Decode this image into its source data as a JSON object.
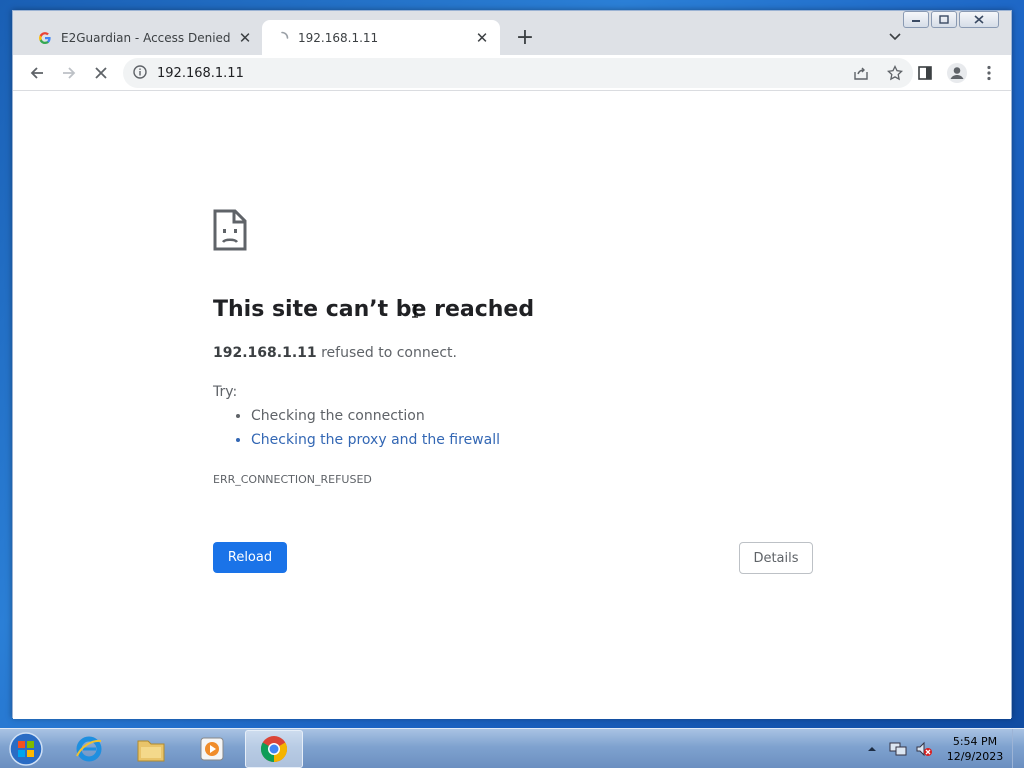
{
  "browser": {
    "tabs": [
      {
        "title": "E2Guardian - Access Denied",
        "favicon": "google-g-icon"
      },
      {
        "title": "192.168.1.11",
        "favicon": "loading-spinner-icon"
      }
    ],
    "url": "192.168.1.11"
  },
  "error_page": {
    "title": "This site can’t be reached",
    "host": "192.168.1.11",
    "message_suffix": " refused to connect.",
    "try_label": "Try:",
    "suggestions": [
      "Checking the connection",
      "Checking the proxy and the firewall"
    ],
    "error_code": "ERR_CONNECTION_REFUSED",
    "reload_label": "Reload",
    "details_label": "Details"
  },
  "taskbar": {
    "time": "5:54 PM",
    "date": "12/9/2023"
  },
  "colors": {
    "accent": "#1a73e8",
    "link": "#3367b4"
  }
}
